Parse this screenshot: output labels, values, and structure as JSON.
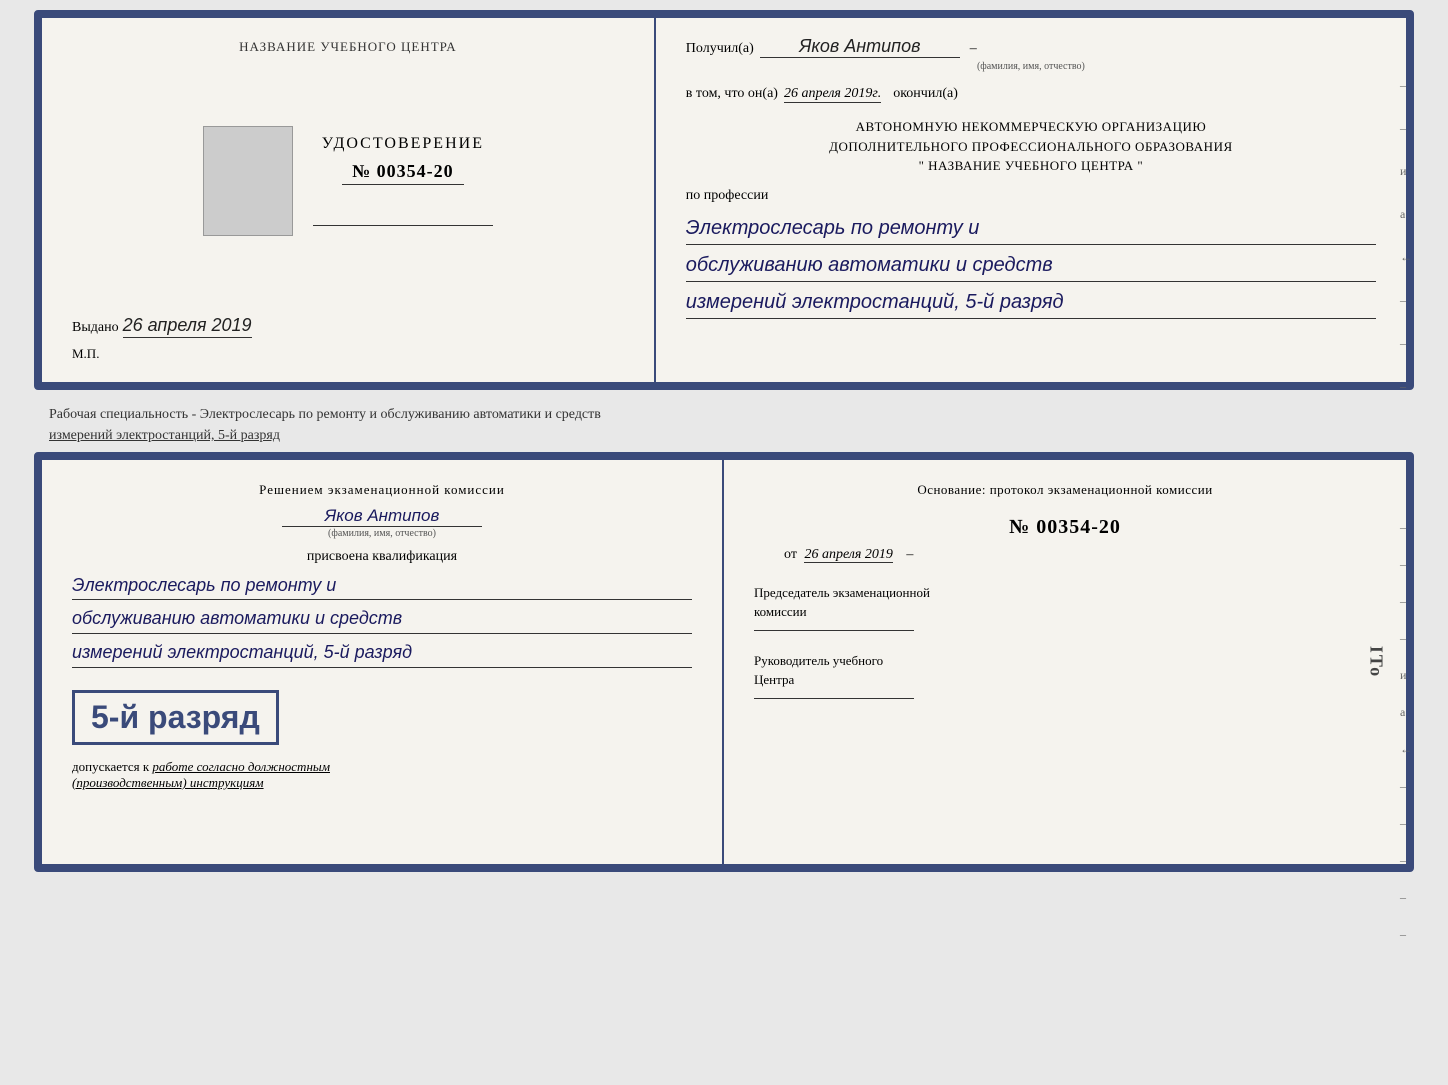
{
  "doc_top": {
    "left": {
      "org_title": "НАЗВАНИЕ УЧЕБНОГО ЦЕНТРА",
      "udostoverenie": "УДОСТОВЕРЕНИЕ",
      "number": "№ 00354-20",
      "vydano_label": "Выдано",
      "vydano_date": "26 апреля 2019",
      "mp_label": "М.П."
    },
    "right": {
      "poluchil_label": "Получил(а)",
      "fio_value": "Яков Антипов",
      "fio_hint": "(фамилия, имя, отчество)",
      "v_tom_label": "в том, что он(а)",
      "date_value": "26 апреля 2019г.",
      "okonchil_label": "окончил(а)",
      "org_block_line1": "АВТОНОМНУЮ НЕКОММЕРЧЕСКУЮ ОРГАНИЗАЦИЮ",
      "org_block_line2": "ДОПОЛНИТЕЛЬНОГО ПРОФЕССИОНАЛЬНОГО ОБРАЗОВАНИЯ",
      "org_block_line3": "\"     НАЗВАНИЕ УЧЕБНОГО ЦЕНТРА     \"",
      "po_professii_label": "по профессии",
      "profession_line1": "Электрослесарь по ремонту и",
      "profession_line2": "обслуживанию автоматики и средств",
      "profession_line3": "измерений электростанций, 5-й разряд"
    },
    "side_dashes": [
      "–",
      "–",
      "и",
      "а",
      "←",
      "–",
      "–",
      "–"
    ]
  },
  "separator": {
    "text_normal": "Рабочая специальность - Электрослесарь по ремонту и обслуживанию автоматики и средств",
    "text_underlined": "измерений электростанций, 5-й разряд"
  },
  "doc_bottom": {
    "left": {
      "resheniem_label": "Решением экзаменационной комиссии",
      "fio_value": "Яков Антипов",
      "fio_hint": "(фамилия, имя, отчество)",
      "prisvoena_label": "присвоена квалификация",
      "qual_line1": "Электрослесарь по ремонту и",
      "qual_line2": "обслуживанию автоматики и средств",
      "qual_line3": "измерений электростанций, 5-й разряд",
      "rank_badge": "5-й разряд",
      "dopuskaetsya_label": "допускается к",
      "dopuskaetsya_value": "работе согласно должностным",
      "dopuskaetsya_value2": "(производственным) инструкциям"
    },
    "right": {
      "osnov_label": "Основание: протокол экзаменационной комиссии",
      "protocol_number": "№ 00354-20",
      "ot_label": "от",
      "ot_date": "26 апреля 2019",
      "chair_title_line1": "Председатель экзаменационной",
      "chair_title_line2": "комиссии",
      "ruk_title_line1": "Руководитель учебного",
      "ruk_title_line2": "Центра",
      "side_dashes": [
        "–",
        "–",
        "–",
        "–",
        "и",
        "а",
        "←",
        "–",
        "–",
        "–",
        "–",
        "–"
      ]
    }
  },
  "ito_text": "ITo"
}
